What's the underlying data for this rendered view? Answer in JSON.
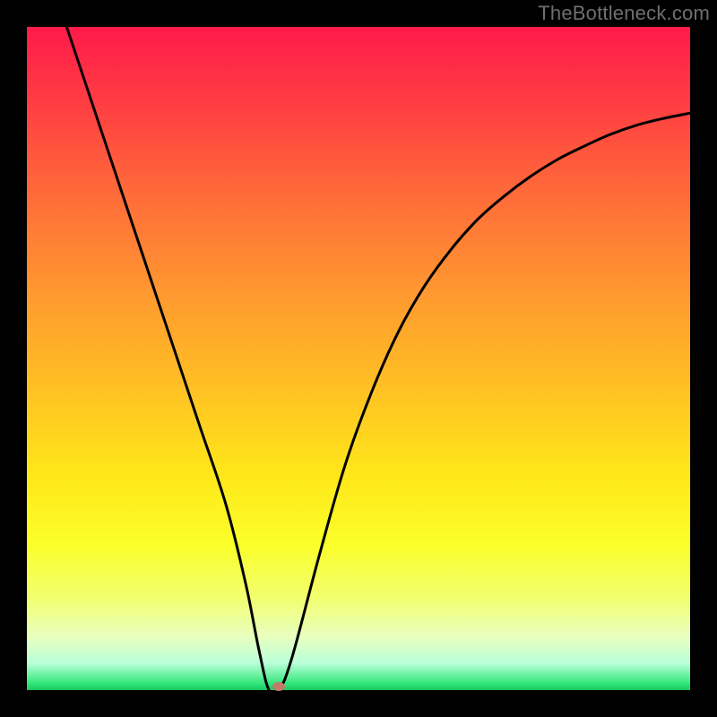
{
  "watermark": "TheBottleneck.com",
  "colors": {
    "frame_bg": "#000000",
    "curve": "#000000",
    "marker": "#c17a6a"
  },
  "chart_data": {
    "type": "line",
    "title": "",
    "xlabel": "",
    "ylabel": "",
    "xlim": [
      0,
      100
    ],
    "ylim": [
      0,
      100
    ],
    "grid": false,
    "legend": false,
    "series": [
      {
        "name": "curve",
        "x": [
          6,
          10,
          14,
          18,
          22,
          26,
          30,
          33,
          35,
          36.5,
          38,
          40,
          44,
          48,
          52,
          56,
          60,
          64,
          68,
          72,
          76,
          80,
          84,
          88,
          92,
          96,
          100
        ],
        "values": [
          100,
          88,
          76,
          64,
          52,
          40,
          28,
          16,
          6,
          0,
          0,
          5,
          20,
          34,
          45,
          54,
          61,
          66.5,
          71,
          74.5,
          77.5,
          80,
          82,
          83.8,
          85.2,
          86.2,
          87
        ]
      }
    ],
    "marker": {
      "x": 38,
      "y": 0.5
    }
  }
}
